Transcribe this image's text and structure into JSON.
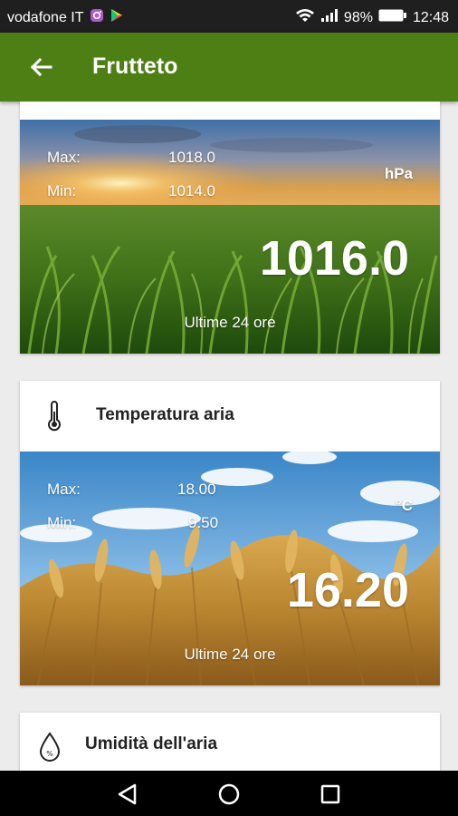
{
  "status_bar": {
    "carrier": "vodafone IT",
    "battery": "98%",
    "time": "12:48"
  },
  "app_bar": {
    "title": "Frutteto"
  },
  "cards": [
    {
      "max_label": "Max:",
      "max_value": "1018.0",
      "min_label": "Min:",
      "min_value": "1014.0",
      "unit": "hPa",
      "current_value": "1016.0",
      "footer": "Ultime 24 ore"
    },
    {
      "title": "Temperatura aria",
      "icon": "thermometer-icon",
      "max_label": "Max:",
      "max_value": "18.00",
      "min_label": "Min:",
      "min_value": "9.50",
      "unit": "°C",
      "current_value": "16.20",
      "footer": "Ultime 24 ore"
    },
    {
      "title": "Umidità dell'aria",
      "icon": "humidity-drop-icon"
    }
  ],
  "colors": {
    "app_bar": "#4d7f14",
    "status_bar": "#1f1f1f",
    "nav_bar": "#000000"
  }
}
